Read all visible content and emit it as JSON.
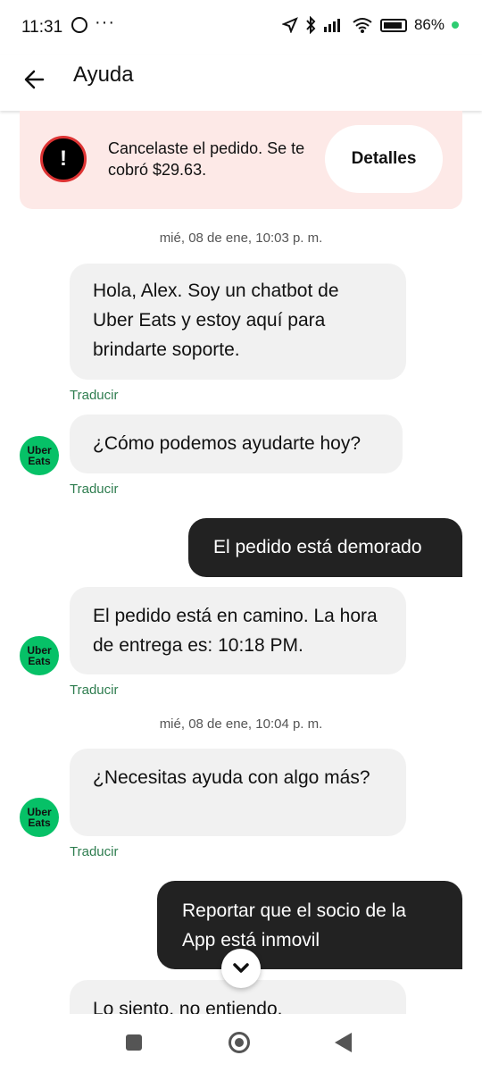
{
  "status_bar": {
    "time": "11:31",
    "more": "···",
    "battery": "86%"
  },
  "header": {
    "title": "Ayuda"
  },
  "banner": {
    "message": "Cancelaste el pedido. Se te cobró $29.63.",
    "details_label": "Detalles"
  },
  "timestamps": [
    "mié, 08 de ene, 10:03 p. m.",
    "mié, 08 de ene, 10:04 p. m."
  ],
  "avatar_label": "Uber Eats",
  "translate_label": "Traducir",
  "messages": [
    {
      "sender": "bot",
      "text": "Hola, Alex. Soy un chatbot de Uber Eats y estoy aquí para brindarte soporte."
    },
    {
      "sender": "bot",
      "text": "¿Cómo podemos ayudarte hoy?"
    },
    {
      "sender": "user",
      "text": "El pedido está demorado"
    },
    {
      "sender": "bot",
      "text": "El pedido está en camino. La hora de entrega es: 10:18 PM."
    },
    {
      "sender": "bot",
      "text": "¿Necesitas ayuda con algo más?"
    },
    {
      "sender": "user",
      "text": "Reportar que el socio de la App está inmovil"
    },
    {
      "sender": "bot",
      "text": "Lo siento, no entiendo."
    }
  ]
}
